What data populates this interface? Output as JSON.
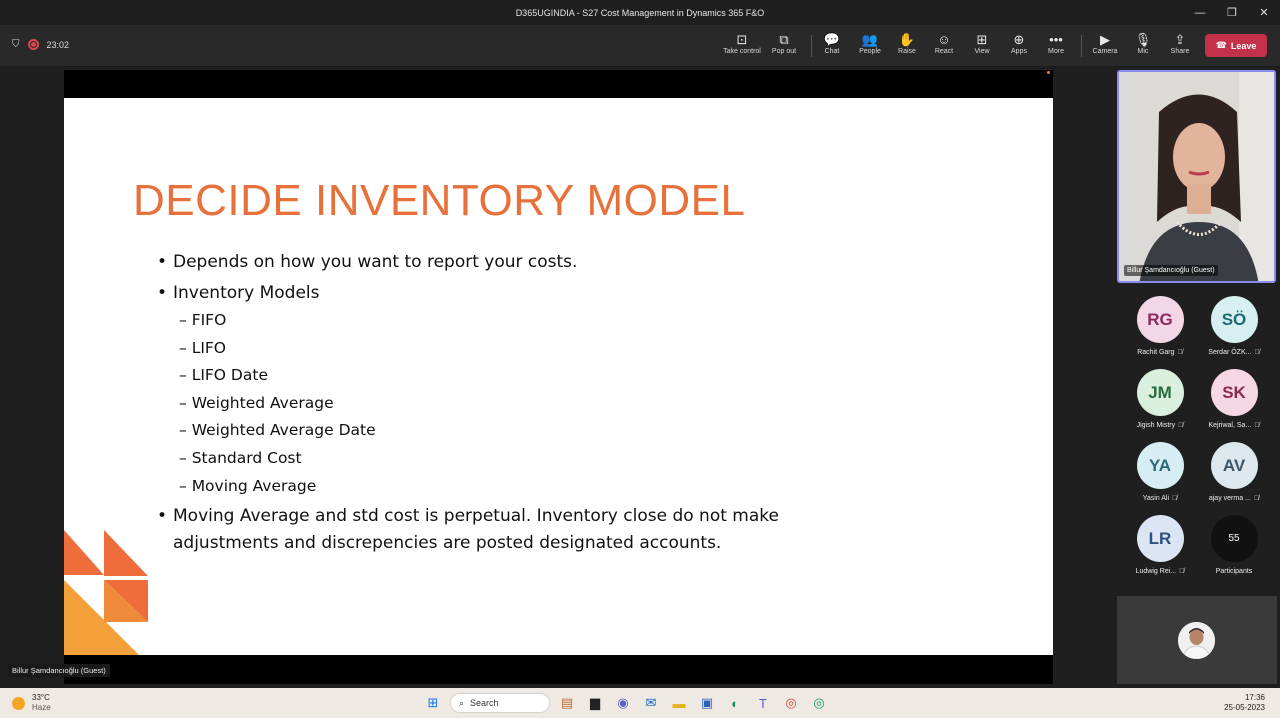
{
  "window": {
    "title": "D365UGINDIA - S27 Cost Management in Dynamics 365 F&O"
  },
  "toolbar": {
    "timer": "23:02",
    "buttons": [
      {
        "label": "Take control",
        "icon": "take-control-icon",
        "glyph": "⊡"
      },
      {
        "label": "Pop out",
        "icon": "pop-out-icon",
        "glyph": "⧉"
      },
      {
        "label": "Chat",
        "icon": "chat-icon",
        "glyph": "💬"
      },
      {
        "label": "People",
        "icon": "people-icon",
        "glyph": "👥"
      },
      {
        "label": "Raise",
        "icon": "raise-hand-icon",
        "glyph": "✋"
      },
      {
        "label": "React",
        "icon": "react-icon",
        "glyph": "☺"
      },
      {
        "label": "View",
        "icon": "view-icon",
        "glyph": "⊞"
      },
      {
        "label": "Apps",
        "icon": "apps-icon",
        "glyph": "⊕"
      },
      {
        "label": "More",
        "icon": "more-icon",
        "glyph": "•••"
      },
      {
        "label": "Camera",
        "icon": "camera-off-icon",
        "glyph": "▶"
      },
      {
        "label": "Mic",
        "icon": "mic-off-icon",
        "glyph": "🎙"
      },
      {
        "label": "Share",
        "icon": "share-icon",
        "glyph": "⇪"
      }
    ],
    "leave_label": "Leave",
    "leave_color": "#c4314b"
  },
  "slide": {
    "title": "DECIDE INVENTORY MODEL",
    "title_color": "#e8703a",
    "bullet_1": "Depends on how you want to report your costs.",
    "bullet_2": "Inventory Models",
    "models": [
      "FIFO",
      "LIFO",
      "LIFO Date",
      "Weighted Average",
      "Weighted Average Date",
      "Standard Cost",
      "Moving Average"
    ],
    "bullet_3_line1": "Moving Average and std cost is perpetual. Inventory close do not make",
    "bullet_3_line2": "adjustments and discrepencies are posted designated accounts."
  },
  "presenter": {
    "name": "Billur Şamdancıoğlu (Guest)"
  },
  "participants": [
    {
      "initials": "RG",
      "name": "Rachit Garg",
      "bg": "#f3d7e8",
      "fg": "#8a2a5f"
    },
    {
      "initials": "SÖ",
      "name": "Serdar ÖZK...",
      "bg": "#d6f0f2",
      "fg": "#1c6b74"
    },
    {
      "initials": "JM",
      "name": "Jigish Mistry",
      "bg": "#d8f0dd",
      "fg": "#2c6b3b"
    },
    {
      "initials": "SK",
      "name": "Kejriwal, Sa...",
      "bg": "#f6d7e4",
      "fg": "#8a2a4f"
    },
    {
      "initials": "YA",
      "name": "Yasin Ali",
      "bg": "#d6eef3",
      "fg": "#2d6b7a"
    },
    {
      "initials": "AV",
      "name": "ajay verma ...",
      "bg": "#dde7ee",
      "fg": "#3c5566"
    },
    {
      "initials": "LR",
      "name": "Ludwig Rei...",
      "bg": "#dce5f3",
      "fg": "#2f4f7d"
    },
    {
      "initials": "55",
      "name": "Participants",
      "bg": "#111111",
      "fg": "#ffffff"
    }
  ],
  "taskbar": {
    "temperature": "33°C",
    "weather": "Haze",
    "search_label": "Search",
    "time": "17:36",
    "date": "25-05-2023"
  }
}
